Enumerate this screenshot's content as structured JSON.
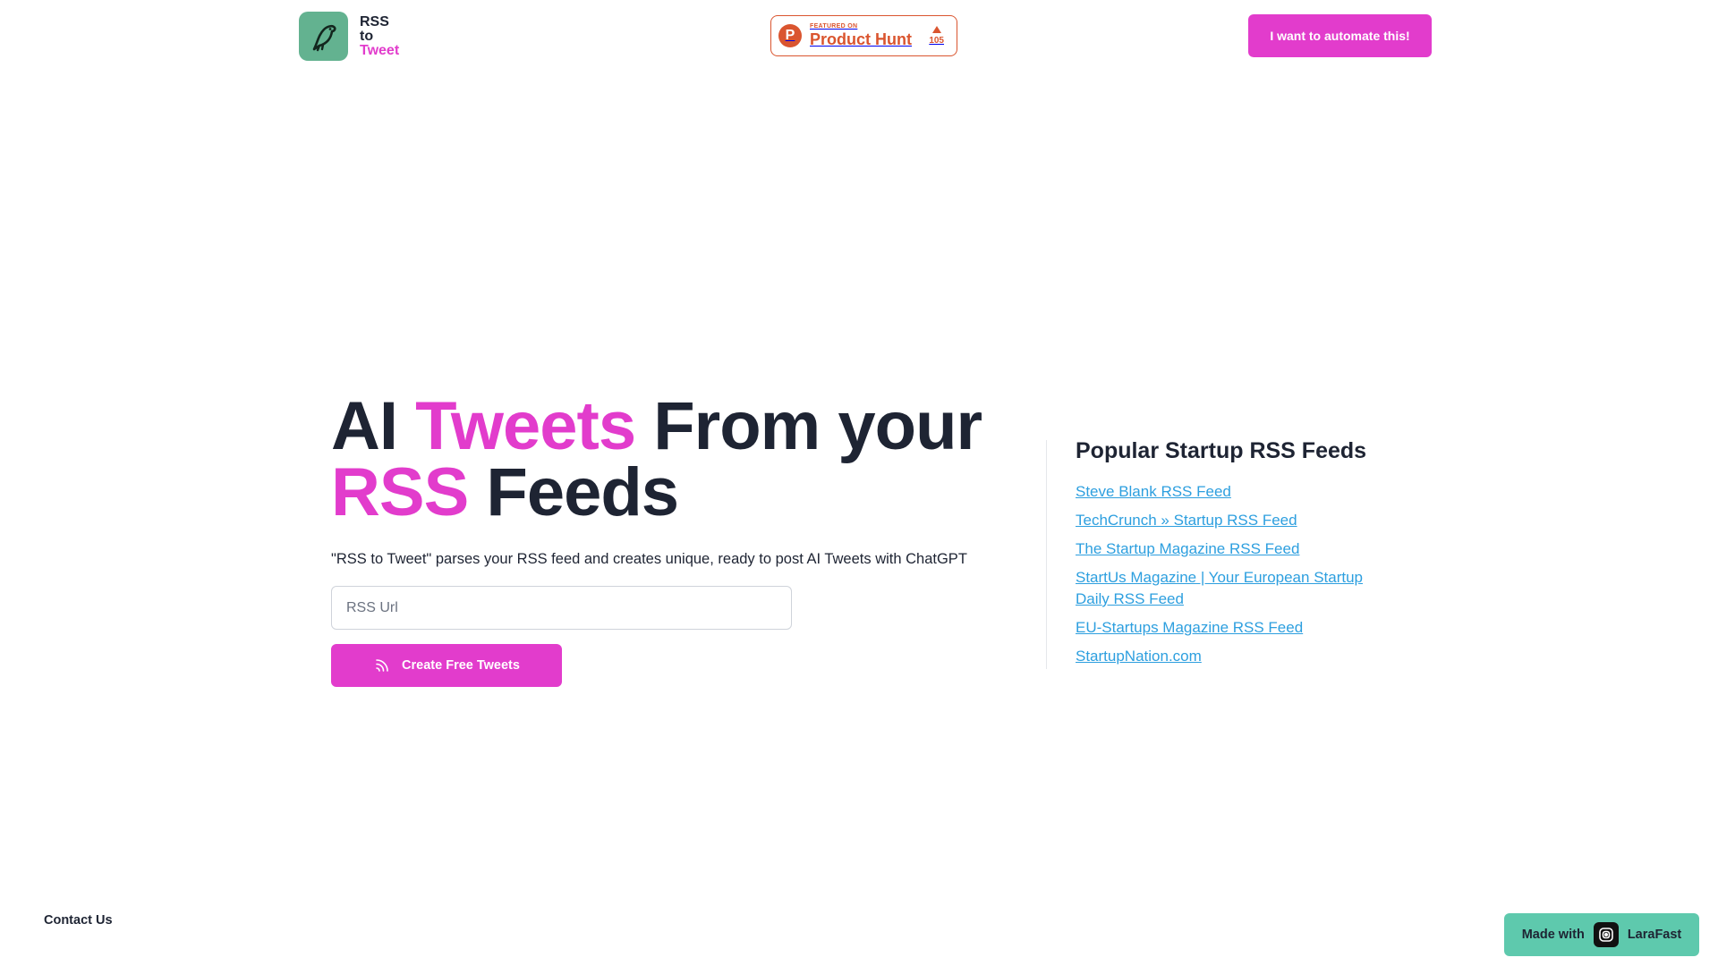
{
  "header": {
    "logo": {
      "line1": "RSS",
      "line2": "to",
      "line3": "Tweet",
      "icon": "bird-icon",
      "bg_color": "#63b290"
    },
    "product_hunt": {
      "featured": "FEATURED ON",
      "name": "Product Hunt",
      "votes": "105",
      "color": "#da552f"
    },
    "automate_button": "I want to automate this!"
  },
  "hero": {
    "title_part1": "AI ",
    "title_accent1": "Tweets",
    "title_part2": " From your",
    "title_accent2": "RSS",
    "title_part3": " Feeds",
    "description": "\"RSS to Tweet\" parses your RSS feed and creates unique, ready to post AI Tweets with ChatGPT",
    "input_placeholder": "RSS Url",
    "create_button": "Create Free Tweets"
  },
  "popular_feeds": {
    "title": "Popular Startup RSS Feeds",
    "items": [
      "Steve Blank RSS Feed",
      "TechCrunch » Startup RSS Feed",
      "The Startup Magazine RSS Feed",
      "StartUs Magazine | Your European Startup Daily RSS Feed",
      "EU-Startups Magazine RSS Feed",
      "StartupNation.com"
    ]
  },
  "footer": {
    "contact": "Contact Us",
    "made_with": "Made with",
    "made_with_brand": "LaraFast"
  },
  "colors": {
    "accent": "#e23ccc",
    "text": "#1e2433",
    "link": "#2d9fdf",
    "made_with_bg": "#5ec9ad"
  }
}
